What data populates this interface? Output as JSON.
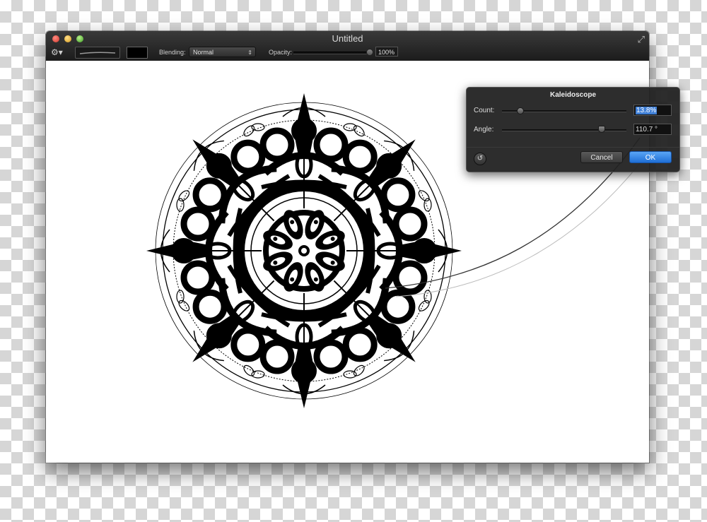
{
  "window": {
    "title": "Untitled"
  },
  "toolbar": {
    "blending_label": "Blending:",
    "blending_value": "Normal",
    "opacity_label": "Opacity:",
    "opacity_value": "100%",
    "opacity_fraction": 1.0
  },
  "kaleidoscope": {
    "title": "Kaleidoscope",
    "count_label": "Count:",
    "count_value": "13.8%",
    "angle_label": "Angle:",
    "angle_value": "110.7 °",
    "cancel_label": "Cancel",
    "ok_label": "OK",
    "accent_color": "#3f7fd6"
  },
  "icons": {
    "gear": "gear-icon",
    "fullscreen": "fullscreen-icon",
    "reset": "reset-icon"
  }
}
